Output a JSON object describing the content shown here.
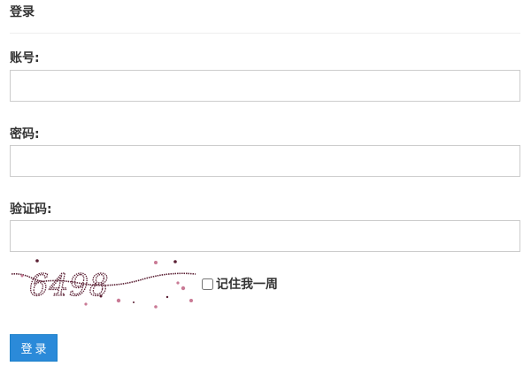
{
  "form": {
    "title": "登录",
    "account": {
      "label": "账号:",
      "value": "",
      "placeholder": ""
    },
    "password": {
      "label": "密码:",
      "value": "",
      "placeholder": ""
    },
    "captcha": {
      "label": "验证码:",
      "value": "",
      "placeholder": "",
      "image_text": "6498"
    },
    "remember": {
      "label": "记住我一周",
      "checked": false
    },
    "submit_label": "登录"
  },
  "colors": {
    "primary": "#2b8ad9",
    "captcha_ink": "#5a1f33",
    "captcha_noise": "#c97a95"
  }
}
